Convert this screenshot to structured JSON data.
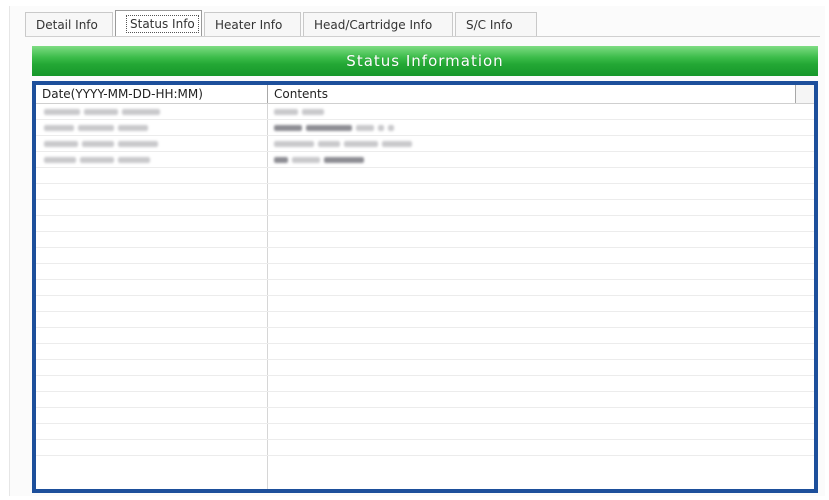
{
  "tabs": [
    {
      "label": "Detail Info",
      "active": false
    },
    {
      "label": "Status Info",
      "active": true
    },
    {
      "label": "Heater Info",
      "active": false
    },
    {
      "label": "Head/Cartridge Info",
      "active": false
    },
    {
      "label": "S/C Info",
      "active": false
    }
  ],
  "banner": {
    "title": "Status Information",
    "color": "#2fae3e"
  },
  "table": {
    "border_color": "#1d4f9b",
    "columns": [
      "Date(YYYY-MM-DD-HH:MM)",
      "Contents"
    ],
    "redacted_row_count": 4,
    "empty_row_count": 18
  }
}
